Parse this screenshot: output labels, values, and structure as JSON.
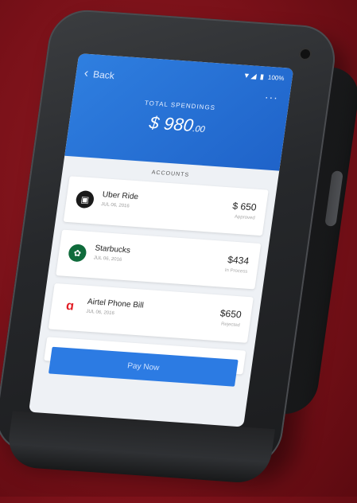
{
  "header": {
    "back_label": "Back",
    "status_icons": "▼◢ ▮",
    "battery_text": "100%",
    "more_glyph": "···",
    "total_label": "TOTAL SPENDINGS",
    "total_amount": "$ 980",
    "total_cents": ".00"
  },
  "accounts_label": "ACCOUNTS",
  "accounts": [
    {
      "title": "Uber Ride",
      "date": "JUL 06, 2016",
      "amount": "$ 650",
      "status": "Approved",
      "icon": "uber-icon",
      "icon_glyph": "▣",
      "icon_color": "#1a1a1a"
    },
    {
      "title": "Starbucks",
      "date": "JUL 06, 2016",
      "amount": "$434",
      "status": "In Process",
      "icon": "starbucks-icon",
      "icon_glyph": "✿",
      "icon_color": "#0f6b3b"
    },
    {
      "title": "Airtel Phone Bill",
      "date": "JUL 06, 2016",
      "amount": "$650",
      "status": "Rejected",
      "icon": "airtel-icon",
      "icon_glyph": "ɑ",
      "icon_color": "#e21e25"
    }
  ],
  "pay_button_label": "Pay Now",
  "colors": {
    "accent": "#2c7be3",
    "background": "#7a1119"
  }
}
